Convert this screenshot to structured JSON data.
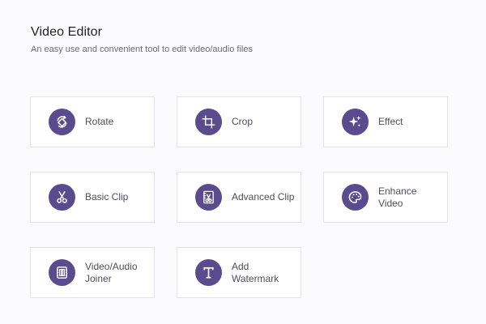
{
  "header": {
    "title": "Video Editor",
    "subtitle": "An easy use and convenient tool to edit video/audio files"
  },
  "accent_color": "#5a4a8e",
  "tools": [
    {
      "label": "Rotate",
      "icon": "rotate-icon"
    },
    {
      "label": "Crop",
      "icon": "crop-icon"
    },
    {
      "label": "Effect",
      "icon": "effect-sparkle-icon"
    },
    {
      "label": "Basic Clip",
      "icon": "scissors-icon"
    },
    {
      "label": "Advanced Clip",
      "icon": "advanced-clip-icon"
    },
    {
      "label": "Enhance\nVideo",
      "icon": "palette-icon"
    },
    {
      "label": "Video/Audio\nJoiner",
      "icon": "joiner-icon"
    },
    {
      "label": "Add\nWatermark",
      "icon": "watermark-text-icon"
    }
  ]
}
